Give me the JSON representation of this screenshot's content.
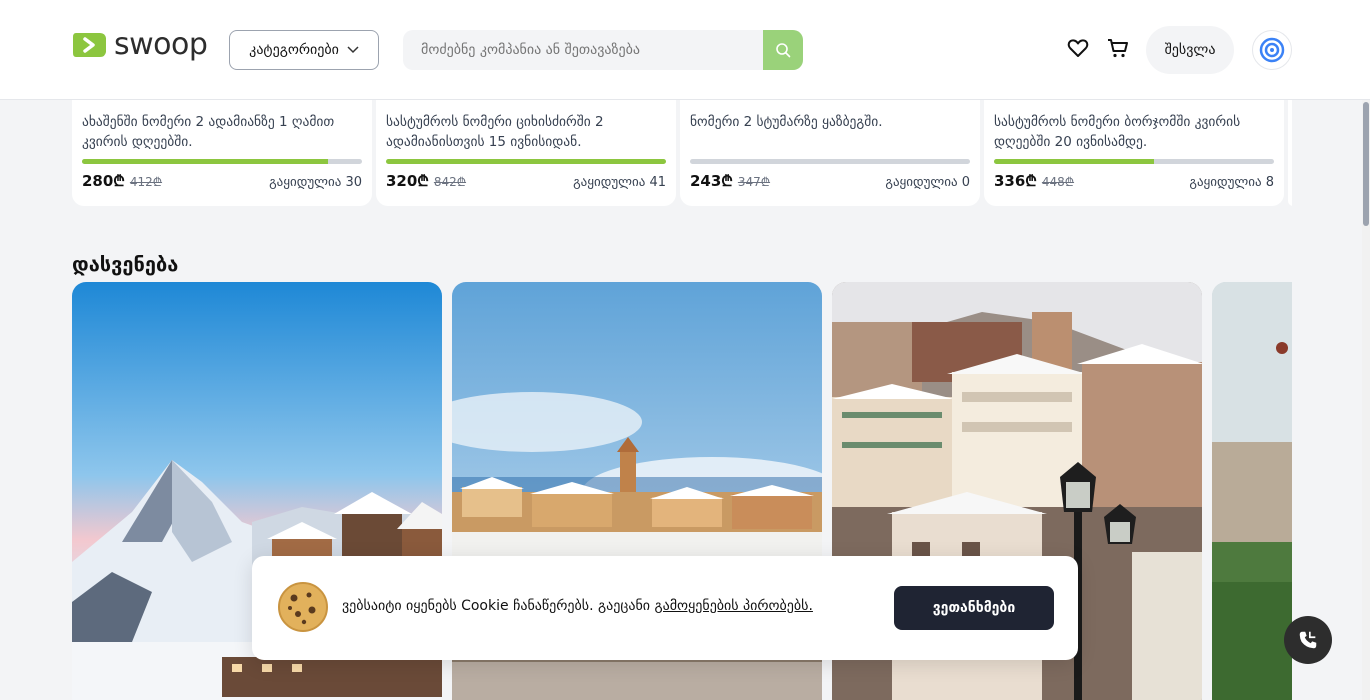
{
  "header": {
    "logo_text": "swoop",
    "categories_label": "კატეგორიები",
    "search_placeholder": "მოძებნე კომპანია ან შეთავაზება",
    "login_label": "შესვლა",
    "brand_color": "#8cc63f"
  },
  "offers": [
    {
      "title": "ახაშენში ნომერი 2 ადამიანზე 1 ღამით კვირის დღეებში.",
      "price": "280₾",
      "old_price": "412₾",
      "sold": "გაყიდულია 30",
      "progress": 0.88
    },
    {
      "title": "სასტუმროს ნომერი ციხისძირში 2 ადამიანისთვის 15 ივნისიდან.",
      "price": "320₾",
      "old_price": "842₾",
      "sold": "გაყიდულია 41",
      "progress": 1.0
    },
    {
      "title": "ნომერი 2 სტუმარზე ყაზბეგში.",
      "price": "243₾",
      "old_price": "347₾",
      "sold": "გაყიდულია 0",
      "progress": 0.0
    },
    {
      "title": "სასტუმროს ნომერი ბორჯომში კვირის დღეებში 20 ივნისამდე.",
      "price": "336₾",
      "old_price": "448₾",
      "sold": "გაყიდულია 8",
      "progress": 0.57
    }
  ],
  "section": {
    "title": "დასვენება"
  },
  "cookie": {
    "text_prefix": "ვებსაიტი იყენებს Cookie ჩანაწერებს. გაეცანი ",
    "link_text": "გამოყენების პირობებს.",
    "accept_label": "ვეთანხმები"
  }
}
